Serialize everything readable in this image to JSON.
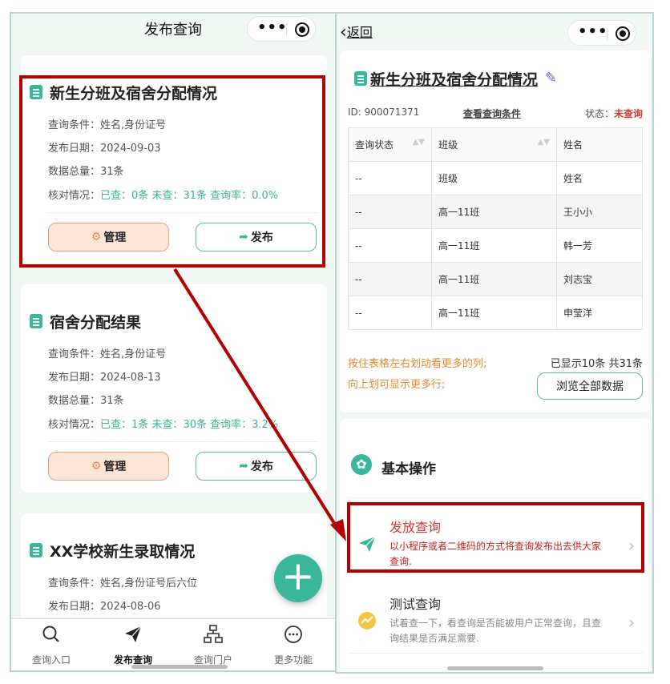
{
  "left": {
    "title": "发布查询",
    "cards": [
      {
        "title": "新生分班及宿舍分配情况",
        "condition": "查询条件：姓名,身份证号",
        "date": "发布日期：2024-09-03",
        "total": "数据总量：31条",
        "check_label": "核对情况：",
        "check_value": "已查：0条 未查：31条 查询率：0.0%",
        "manage_label": "管理",
        "publish_label": "发布"
      },
      {
        "title": "宿舍分配结果",
        "condition": "查询条件：姓名,身份证号",
        "date": "发布日期：2024-08-13",
        "total": "数据总量：31条",
        "check_label": "核对情况：",
        "check_value": "已查：1条 未查：30条 查询率：3.2%",
        "manage_label": "管理",
        "publish_label": "发布"
      },
      {
        "title": "XX学校新生录取情况",
        "condition": "查询条件：姓名,身份证号后六位",
        "date": "发布日期：2024-08-06"
      }
    ],
    "tabs": [
      {
        "label": "查询入口",
        "icon": "search-icon"
      },
      {
        "label": "发布查询",
        "icon": "paper-plane-icon"
      },
      {
        "label": "查询门户",
        "icon": "sitemap-icon"
      },
      {
        "label": "更多功能",
        "icon": "more-circle-icon"
      }
    ]
  },
  "right": {
    "back_label": "返回",
    "title": "新生分班及宿舍分配情况",
    "id_text": "ID: 900071371",
    "view_conditions": "查看查询条件",
    "status_label": "状态：",
    "status_value": "未查询",
    "table": {
      "headers": [
        "查询状态",
        "班级",
        "姓名"
      ],
      "rows": [
        [
          "--",
          "班级",
          "姓名"
        ],
        [
          "--",
          "高一11班",
          "王小小"
        ],
        [
          "--",
          "高一11班",
          "韩一芳"
        ],
        [
          "--",
          "高一11班",
          "刘志宝"
        ],
        [
          "--",
          "高一11班",
          "申莹洋"
        ]
      ]
    },
    "hint1": "按住表格左右划动看更多的列;",
    "hint2": "向上划可显示更多行;",
    "shown_text": "已显示10条 共31条",
    "browse_label": "浏览全部数据",
    "section_title": "基本操作",
    "ops": [
      {
        "title": "发放查询",
        "desc": "以小程序或者二维码的方式将查询发布出去供大家查询."
      },
      {
        "title": "测试查询",
        "desc": "试着查一下，看查询是否能被用户正常查询，且查询结果是否满足需要."
      }
    ]
  },
  "colors": {
    "accent": "#3ab69a",
    "highlight": "#b30000",
    "warning_text": "#e68a2e",
    "status_red": "#d9382b"
  }
}
